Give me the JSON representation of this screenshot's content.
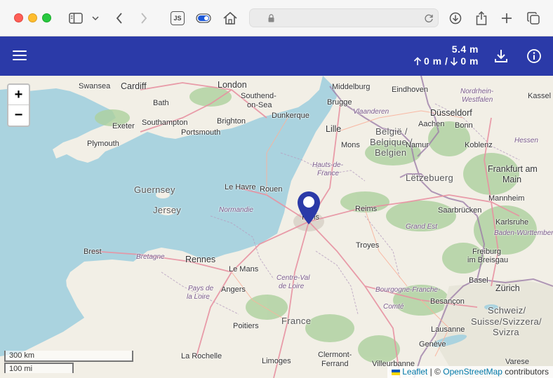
{
  "browser": {
    "js_badge": "JS"
  },
  "header": {
    "elevation_total": "5.4 m",
    "ascent": "0 m /",
    "descent": "0 m"
  },
  "map": {
    "zoom_in": "+",
    "zoom_out": "−",
    "scale_metric": "300 km",
    "scale_imperial": "100 mi",
    "attribution_leaflet": "Leaflet",
    "attribution_sep": "| ©",
    "attribution_osm": "OpenStreetMap",
    "attribution_suffix": "contributors",
    "labels": {
      "swansea": "Swansea",
      "cardiff": "Cardiff",
      "london": "London",
      "southend": "Southend-",
      "onsea": "on-Sea",
      "bath": "Bath",
      "middelburg": "Middelburg",
      "eindhoven": "Eindhoven",
      "nordrhein": "Nordrhein-",
      "westfalen": "Westfalen",
      "kassel": "Kassel",
      "brugge": "Brugge",
      "vlaanderen": "Vlaanderen",
      "dusseldorf": "Düsseldorf",
      "exeter": "Exeter",
      "southampton": "Southampton",
      "brighton": "Brighton",
      "dunkerque": "Dunkerque",
      "portsmouth": "Portsmouth",
      "aachen": "Aachen",
      "bonn": "Bonn",
      "lille": "Lille",
      "belgie": "België /",
      "belgique": "Belgique /",
      "belgien": "Belgien",
      "plymouth": "Plymouth",
      "mons": "Mons",
      "namur": "Namur",
      "koblenz": "Koblenz",
      "hessen": "Hessen",
      "hautsde": "Hauts-de-",
      "france_region": "France",
      "frankfurt": "Frankfurt am",
      "main": "Main",
      "letzebuerg": "Lëtzebuerg",
      "guernsey": "Guernsey",
      "lehavre": "Le Havre",
      "rouen": "Rouen",
      "jersey": "Jersey",
      "normandie": "Normandie",
      "reims": "Reims",
      "mannheim": "Mannheim",
      "paris": "Paris",
      "saarbrucken": "Saarbrücken",
      "karlsruhe": "Karlsruhe",
      "grandest": "Grand Est",
      "badenw": "Baden-Württember",
      "brest": "Brest",
      "troyes": "Troyes",
      "freiburg": "Freiburg",
      "imbreisgau": "im Breisgau",
      "bretagne": "Bretagne",
      "rennes": "Rennes",
      "lemans": "Le Mans",
      "centre": "Centre-Val",
      "deloire": "de Loire",
      "basel": "Basel",
      "paysde": "Pays de",
      "laloire": "la Loire",
      "angers": "Angers",
      "zurich": "Zürich",
      "bourgogne": "Bourgogne-Franche-",
      "comte": "Comté",
      "besancon": "Besançon",
      "france": "France",
      "schweiz": "Schweiz/",
      "suisse": "Suisse/Svizzera/",
      "svizra": "Svizra",
      "poitiers": "Poitiers",
      "lausanne": "Lausanne",
      "geneve": "Genève",
      "larochelle": "La Rochelle",
      "limoges": "Limoges",
      "clermont": "Clermont-",
      "ferrand": "Ferrand",
      "villeurbanne": "Villeurbanne",
      "varese": "Varese"
    }
  }
}
